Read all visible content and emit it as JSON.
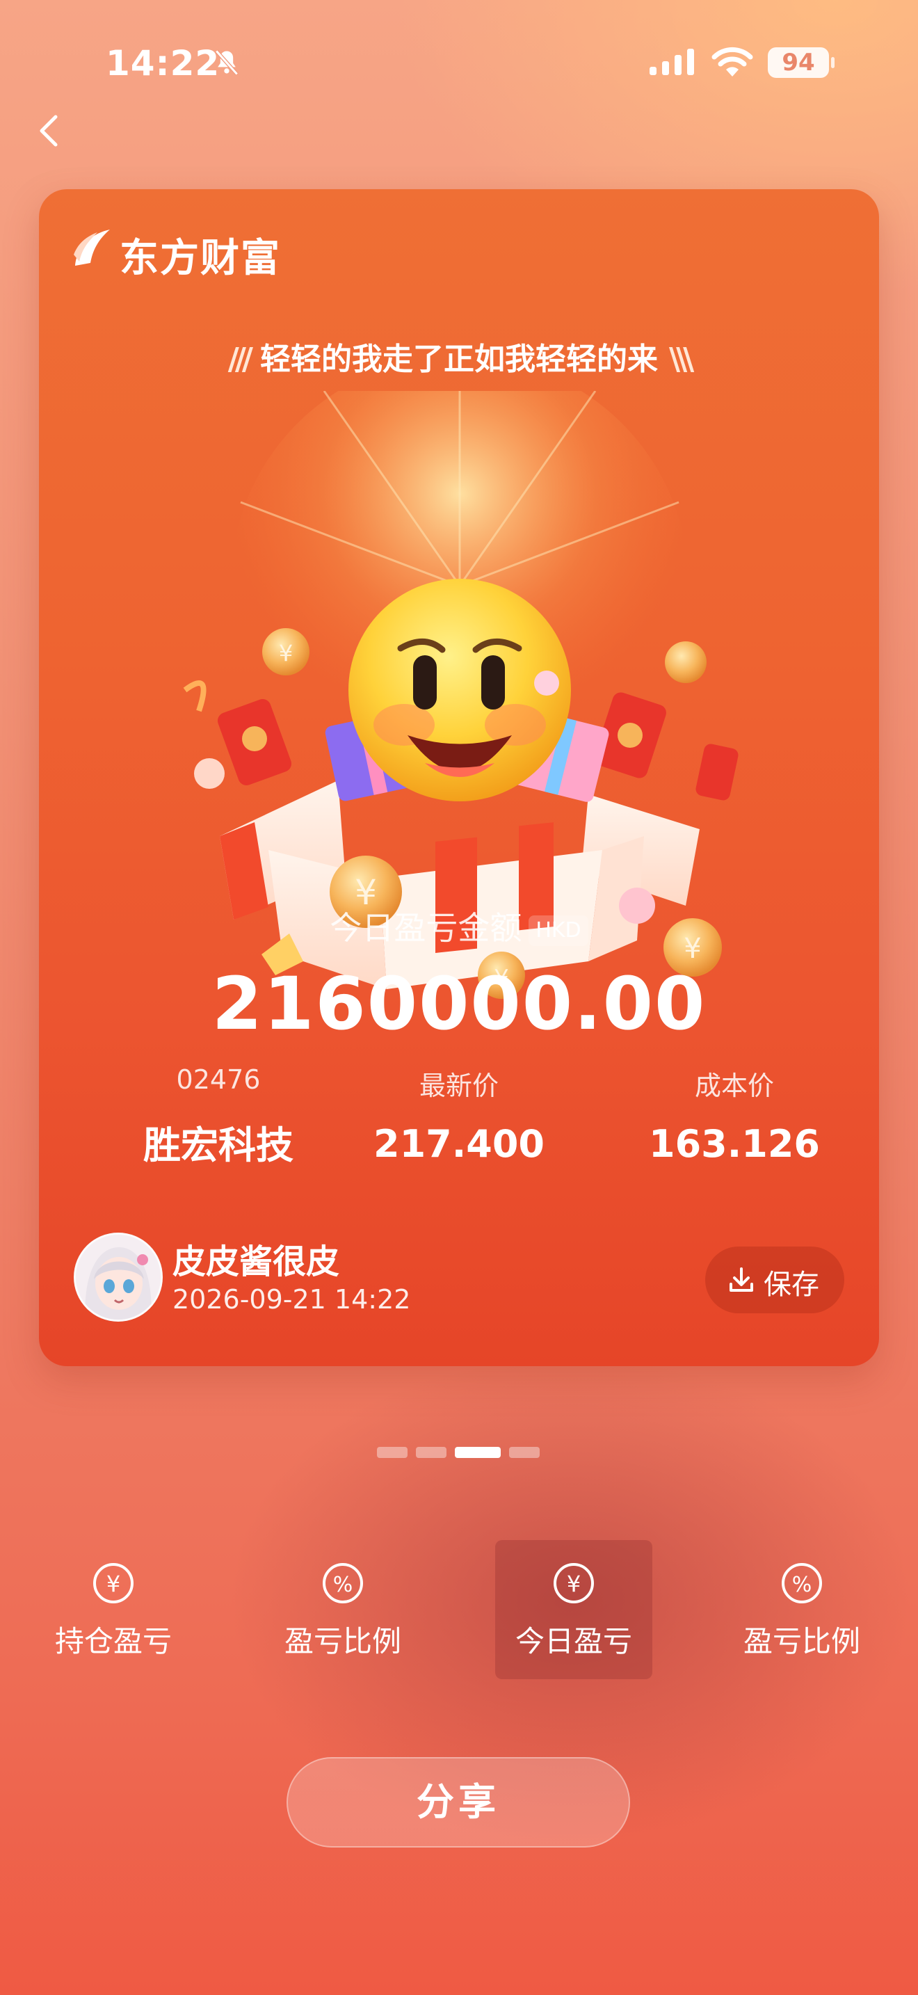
{
  "status_bar": {
    "time": "14:22",
    "battery": "94"
  },
  "card": {
    "brand": "东方财富",
    "slogan": "轻轻的我走了正如我轻轻的来",
    "pnl_label": "今日盈亏金额",
    "currency": "HKD",
    "pnl_amount": "2160000.00",
    "stats": [
      {
        "label": "02476",
        "value": "胜宏科技"
      },
      {
        "label": "最新价",
        "value": "217.400"
      },
      {
        "label": "成本价",
        "value": "163.126"
      }
    ],
    "user": {
      "name": "皮皮酱很皮",
      "datetime": "2026-09-21 14:22"
    },
    "save_label": "保存"
  },
  "pager": {
    "count": 4,
    "active_index": 2
  },
  "tabs": [
    {
      "label": "持仓盈亏",
      "icon": "yuan-icon"
    },
    {
      "label": "盈亏比例",
      "icon": "percent-icon"
    },
    {
      "label": "今日盈亏",
      "icon": "yuan-icon",
      "active": true
    },
    {
      "label": "盈亏比例",
      "icon": "percent-icon"
    }
  ],
  "share_label": "分享",
  "colors": {
    "card_top": "#ef6f35",
    "card_bottom": "#e64528",
    "accent_text": "#ffffff"
  }
}
